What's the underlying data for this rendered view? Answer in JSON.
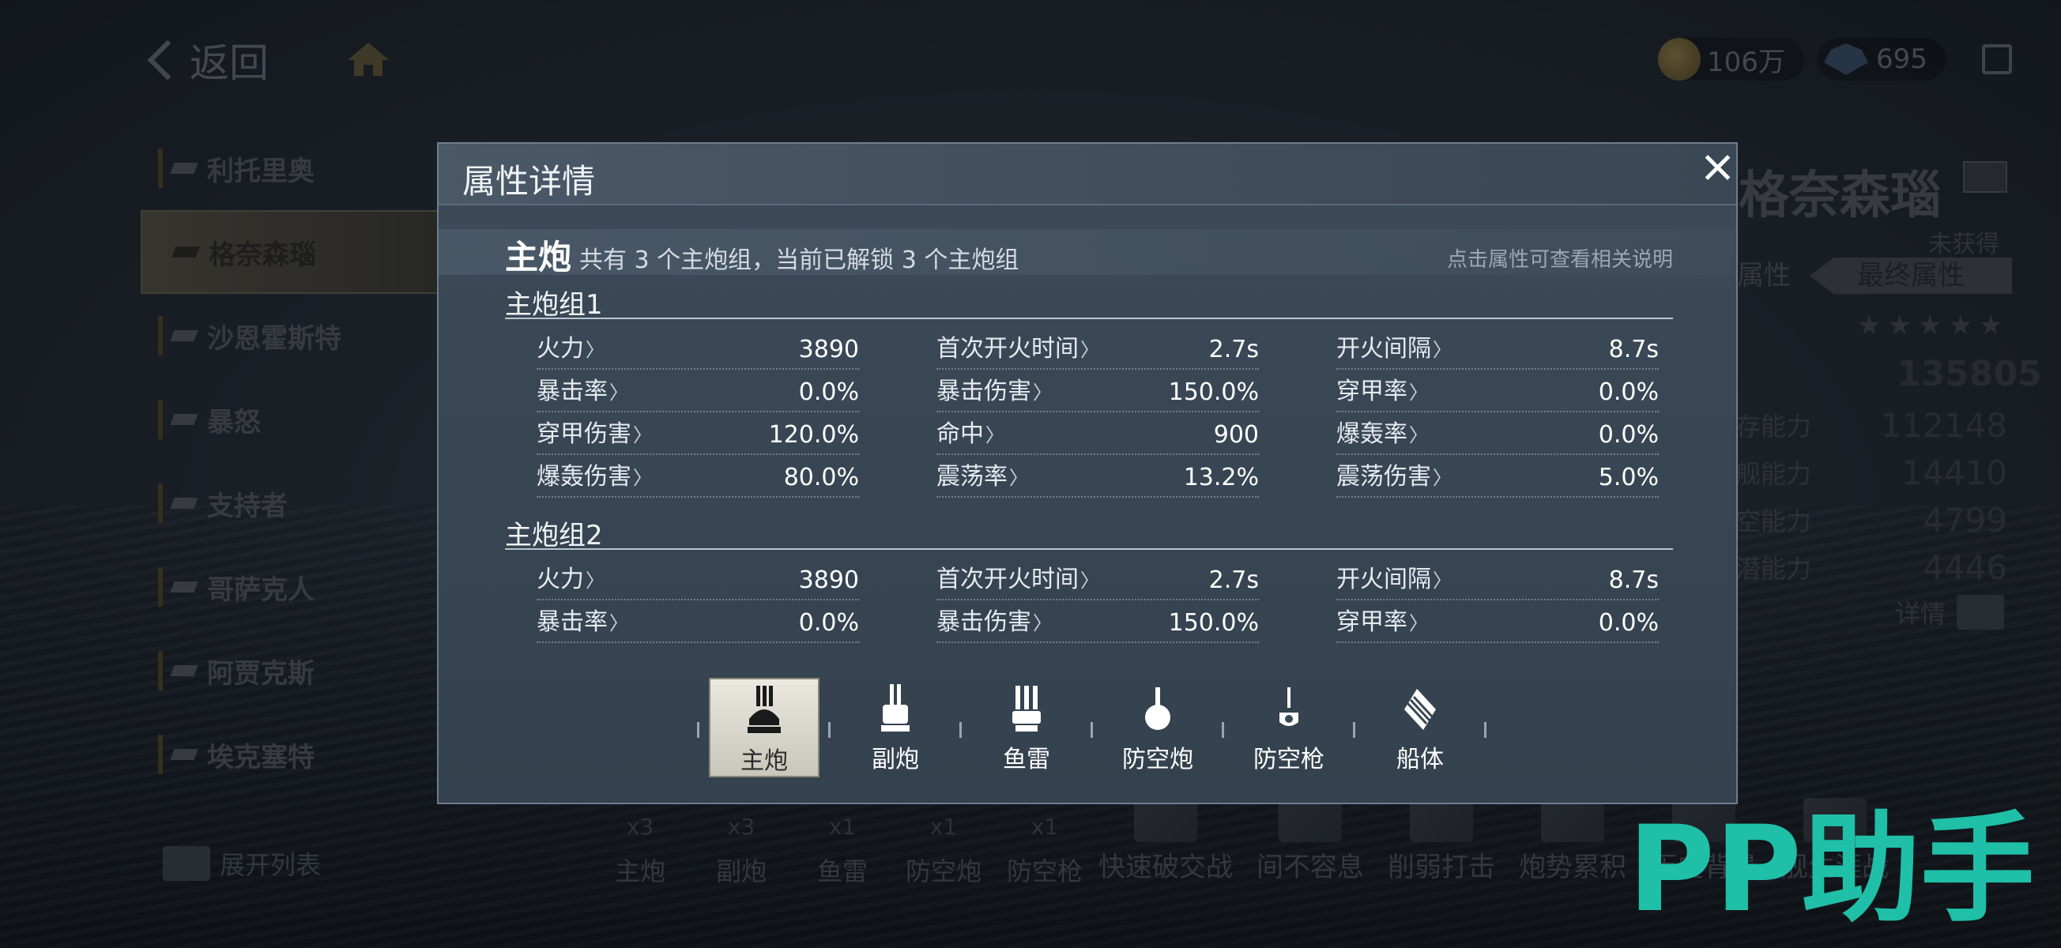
{
  "top_bar": {
    "back_label": "返回",
    "gold": "106万",
    "gems": "695"
  },
  "ship_list": {
    "items": [
      {
        "name": "利托里奥",
        "active": false
      },
      {
        "name": "格奈森瑙",
        "active": true
      },
      {
        "name": "沙恩霍斯特",
        "active": false
      },
      {
        "name": "暴怒",
        "active": false
      },
      {
        "name": "支持者",
        "active": false
      },
      {
        "name": "哥萨克人",
        "active": false
      },
      {
        "name": "阿贾克斯",
        "active": false
      },
      {
        "name": "埃克塞特",
        "active": false
      }
    ],
    "expand_label": "展开列表"
  },
  "ship_panel": {
    "name": "格奈森瑙",
    "status": "未获得",
    "tab_base": "属性",
    "tab_final": "最终属性",
    "total": "135805",
    "stats": [
      {
        "label": "存能力",
        "value": "112148"
      },
      {
        "label": "舰能力",
        "value": "14410"
      },
      {
        "label": "空能力",
        "value": "4799"
      },
      {
        "label": "潜能力",
        "value": "4446"
      }
    ],
    "detail_label": "详情"
  },
  "bottom_bar": {
    "weapons": [
      {
        "label": "主炮",
        "count": "x3"
      },
      {
        "label": "副炮",
        "count": "x3"
      },
      {
        "label": "鱼雷",
        "count": "x1"
      },
      {
        "label": "防空炮",
        "count": "x1"
      },
      {
        "label": "防空枪",
        "count": "x1"
      }
    ],
    "skills": [
      "快速破交战",
      "间不容息",
      "削弱打击",
      "炮势累积",
      "历史背景",
      "舰生涯战"
    ]
  },
  "modal": {
    "title": "属性详情",
    "section_main": "主炮",
    "section_desc": "共有 3 个主炮组，当前已解锁 3 个主炮组",
    "section_hint": "点击属性可查看相关说明",
    "groups": [
      {
        "title": "主炮组1",
        "stats": [
          {
            "label": "火力",
            "value": "3890"
          },
          {
            "label": "首次开火时间",
            "value": "2.7s"
          },
          {
            "label": "开火间隔",
            "value": "8.7s"
          },
          {
            "label": "暴击率",
            "value": "0.0%"
          },
          {
            "label": "暴击伤害",
            "value": "150.0%"
          },
          {
            "label": "穿甲率",
            "value": "0.0%"
          },
          {
            "label": "穿甲伤害",
            "value": "120.0%"
          },
          {
            "label": "命中",
            "value": "900"
          },
          {
            "label": "爆轰率",
            "value": "0.0%"
          },
          {
            "label": "爆轰伤害",
            "value": "80.0%"
          },
          {
            "label": "震荡率",
            "value": "13.2%"
          },
          {
            "label": "震荡伤害",
            "value": "5.0%"
          }
        ]
      },
      {
        "title": "主炮组2",
        "stats": [
          {
            "label": "火力",
            "value": "3890"
          },
          {
            "label": "首次开火时间",
            "value": "2.7s"
          },
          {
            "label": "开火间隔",
            "value": "8.7s"
          },
          {
            "label": "暴击率",
            "value": "0.0%"
          },
          {
            "label": "暴击伤害",
            "value": "150.0%"
          },
          {
            "label": "穿甲率",
            "value": "0.0%"
          }
        ]
      }
    ],
    "weapon_tabs": [
      {
        "label": "主炮",
        "icon": "main-gun-icon",
        "active": true
      },
      {
        "label": "副炮",
        "icon": "secondary-gun-icon",
        "active": false
      },
      {
        "label": "鱼雷",
        "icon": "torpedo-icon",
        "active": false
      },
      {
        "label": "防空炮",
        "icon": "aa-cannon-icon",
        "active": false
      },
      {
        "label": "防空枪",
        "icon": "aa-gun-icon",
        "active": false
      },
      {
        "label": "船体",
        "icon": "hull-icon",
        "active": false
      }
    ]
  },
  "watermark": {
    "text": "PP助手",
    "color": "#1fbfa8"
  }
}
